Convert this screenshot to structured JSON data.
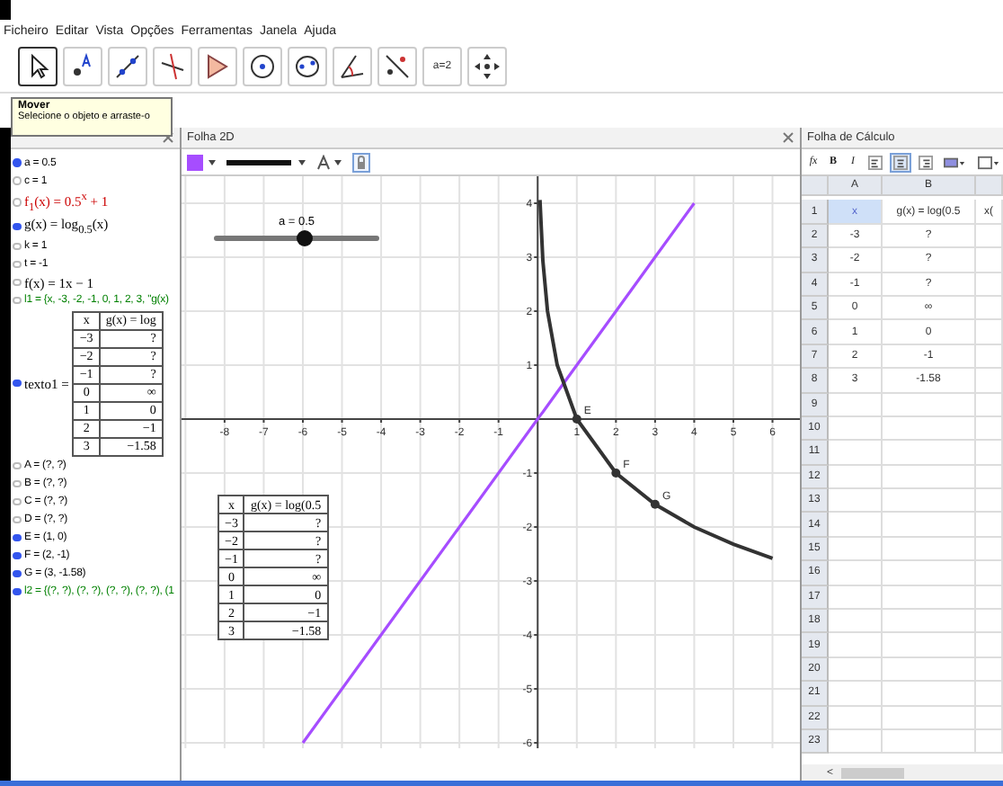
{
  "menu": [
    "Ficheiro",
    "Editar",
    "Vista",
    "Opções",
    "Ferramentas",
    "Janela",
    "Ajuda"
  ],
  "toolbar": [
    {
      "kind": "move",
      "selected": true
    },
    {
      "kind": "point",
      "selected": false
    },
    {
      "kind": "line",
      "selected": false
    },
    {
      "kind": "perpendicular",
      "selected": false
    },
    {
      "kind": "polygon",
      "selected": false
    },
    {
      "kind": "circle",
      "selected": false
    },
    {
      "kind": "conic",
      "selected": false
    },
    {
      "kind": "angle",
      "selected": false
    },
    {
      "kind": "reflect",
      "selected": false
    },
    {
      "kind": "slider",
      "label": "a=2",
      "selected": false
    },
    {
      "kind": "pan",
      "selected": false
    }
  ],
  "tooltip": {
    "title": "Mover",
    "text": "Selecione o objeto e arraste-o"
  },
  "algebra": {
    "items": [
      {
        "kind": "text",
        "text": "a = 0.5",
        "visible": true,
        "color": "#000000"
      },
      {
        "kind": "text",
        "text": "c = 1",
        "visible": false,
        "color": "#000000"
      },
      {
        "kind": "formula",
        "text": "f$_{1}$(x) = 0.5$^{x}$ + 1",
        "visible": false,
        "color": "#cc0000"
      },
      {
        "kind": "formula",
        "text": "g(x) = log$_{0.5}$(x)",
        "visible": true,
        "color": "#000000"
      },
      {
        "kind": "text",
        "text": "k = 1",
        "visible": false,
        "color": "#000000"
      },
      {
        "kind": "text",
        "text": "t = -1",
        "visible": false,
        "color": "#000000"
      },
      {
        "kind": "formula",
        "text": "f(x) = 1x − 1",
        "visible": false,
        "color": "#000000"
      },
      {
        "kind": "text",
        "text": "l1 = {x, -3, -2, -1, 0, 1, 2, 3, \"g(x)",
        "visible": false,
        "color": "#008000"
      },
      {
        "kind": "table",
        "text": "texto1 =",
        "visible": true,
        "color": "#000000",
        "table": {
          "header": [
            "x",
            "g(x) = log"
          ],
          "rows": [
            [
              "−3",
              "?"
            ],
            [
              "−2",
              "?"
            ],
            [
              "−1",
              "?"
            ],
            [
              "0",
              "∞"
            ],
            [
              "1",
              "0"
            ],
            [
              "2",
              "−1"
            ],
            [
              "3",
              "−1.58"
            ]
          ]
        }
      },
      {
        "kind": "text",
        "text": "A = (?, ?)",
        "visible": false,
        "color": "#000000"
      },
      {
        "kind": "text",
        "text": "B = (?, ?)",
        "visible": false,
        "color": "#000000"
      },
      {
        "kind": "text",
        "text": "C = (?, ?)",
        "visible": false,
        "color": "#000000"
      },
      {
        "kind": "text",
        "text": "D = (?, ?)",
        "visible": false,
        "color": "#000000"
      },
      {
        "kind": "text",
        "text": "E = (1, 0)",
        "visible": true,
        "color": "#000000"
      },
      {
        "kind": "text",
        "text": "F = (2, -1)",
        "visible": true,
        "color": "#000000"
      },
      {
        "kind": "text",
        "text": "G = (3, -1.58)",
        "visible": true,
        "color": "#000000"
      },
      {
        "kind": "text",
        "text": "l2 = {(?, ?), (?, ?), (?, ?), (?, ?), (1",
        "visible": true,
        "color": "#008000"
      }
    ]
  },
  "graphics": {
    "title": "Folha 2D",
    "slider": {
      "label": "a = 0.5",
      "level": 0.55
    },
    "table": {
      "header": [
        "x",
        "g(x) = log(0.5"
      ],
      "rows": [
        [
          "−3",
          "?"
        ],
        [
          "−2",
          "?"
        ],
        [
          "−1",
          "?"
        ],
        [
          "0",
          "∞"
        ],
        [
          "1",
          "0"
        ],
        [
          "2",
          "−1"
        ],
        [
          "3",
          "−1.58"
        ]
      ]
    },
    "chart_data": {
      "type": "line",
      "x": [
        -6,
        -4,
        -2,
        0,
        0.06,
        0.13,
        0.25,
        0.5,
        1,
        2,
        3,
        4,
        5,
        6
      ],
      "series": [
        {
          "color": "#a64dff",
          "values": [
            -6,
            -4,
            -2,
            0,
            0.06,
            0.13,
            0.25,
            0.5,
            1,
            2,
            3,
            4,
            null,
            null
          ]
        },
        {
          "color": "#333333",
          "values": [
            null,
            null,
            null,
            null,
            4.06,
            2.94,
            2,
            1,
            0,
            -1,
            -1.58,
            -2,
            -2.32,
            -2.58
          ]
        }
      ],
      "xlim": [
        -9.1,
        6.7
      ],
      "ylim": [
        -6.1,
        4.5
      ],
      "grid": true,
      "xticks": [
        -8,
        -7,
        -6,
        -5,
        -4,
        -3,
        -2,
        -1,
        1,
        2,
        3,
        4,
        5,
        6
      ],
      "yticks": [
        -6,
        -5,
        -4,
        -3,
        -2,
        -1,
        1,
        2,
        3,
        4
      ],
      "annotations": [
        {
          "x": 1,
          "y": 0,
          "text": "E"
        },
        {
          "x": 2,
          "y": -1,
          "text": "F"
        },
        {
          "x": 3,
          "y": -1.58,
          "text": "G"
        }
      ]
    }
  },
  "spreadsheet": {
    "title": "Folha de Cálculo",
    "toolbar": [
      {
        "kind": "text",
        "label": "fx",
        "selected": false
      },
      {
        "kind": "text",
        "label": "B",
        "selected": false
      },
      {
        "kind": "text",
        "label": "I",
        "selected": false
      },
      {
        "kind": "align-left",
        "selected": false
      },
      {
        "kind": "align-center",
        "selected": true
      },
      {
        "kind": "align-right",
        "selected": false
      },
      {
        "kind": "fill",
        "selected": false
      },
      {
        "kind": "border",
        "selected": false
      }
    ],
    "columns": [
      "A",
      "B"
    ],
    "rows": [
      {
        "number": "1",
        "cells": [
          {
            "text": "x",
            "selected": true
          },
          {
            "text": "g(x) = log(0.5",
            "selected": false
          },
          {
            "text": "x(",
            "selected": false
          }
        ]
      },
      {
        "number": "2",
        "cells": [
          {
            "text": "-3",
            "selected": false
          },
          {
            "text": "?",
            "selected": false
          }
        ]
      },
      {
        "number": "3",
        "cells": [
          {
            "text": "-2",
            "selected": false
          },
          {
            "text": "?",
            "selected": false
          }
        ]
      },
      {
        "number": "4",
        "cells": [
          {
            "text": "-1",
            "selected": false
          },
          {
            "text": "?",
            "selected": false
          }
        ]
      },
      {
        "number": "5",
        "cells": [
          {
            "text": "0",
            "selected": false
          },
          {
            "text": "∞",
            "selected": false
          }
        ]
      },
      {
        "number": "6",
        "cells": [
          {
            "text": "1",
            "selected": false
          },
          {
            "text": "0",
            "selected": false
          }
        ]
      },
      {
        "number": "7",
        "cells": [
          {
            "text": "2",
            "selected": false
          },
          {
            "text": "-1",
            "selected": false
          }
        ]
      },
      {
        "number": "8",
        "cells": [
          {
            "text": "3",
            "selected": false
          },
          {
            "text": "-1.58",
            "selected": false
          }
        ]
      },
      {
        "number": "9",
        "cells": []
      },
      {
        "number": "10",
        "cells": []
      },
      {
        "number": "11",
        "cells": []
      },
      {
        "number": "12",
        "cells": []
      },
      {
        "number": "13",
        "cells": []
      },
      {
        "number": "14",
        "cells": []
      },
      {
        "number": "15",
        "cells": []
      },
      {
        "number": "16",
        "cells": []
      },
      {
        "number": "17",
        "cells": []
      },
      {
        "number": "18",
        "cells": []
      },
      {
        "number": "19",
        "cells": []
      },
      {
        "number": "20",
        "cells": []
      },
      {
        "number": "21",
        "cells": []
      },
      {
        "number": "22",
        "cells": []
      },
      {
        "number": "23",
        "cells": []
      }
    ],
    "scroll_left": "<"
  }
}
